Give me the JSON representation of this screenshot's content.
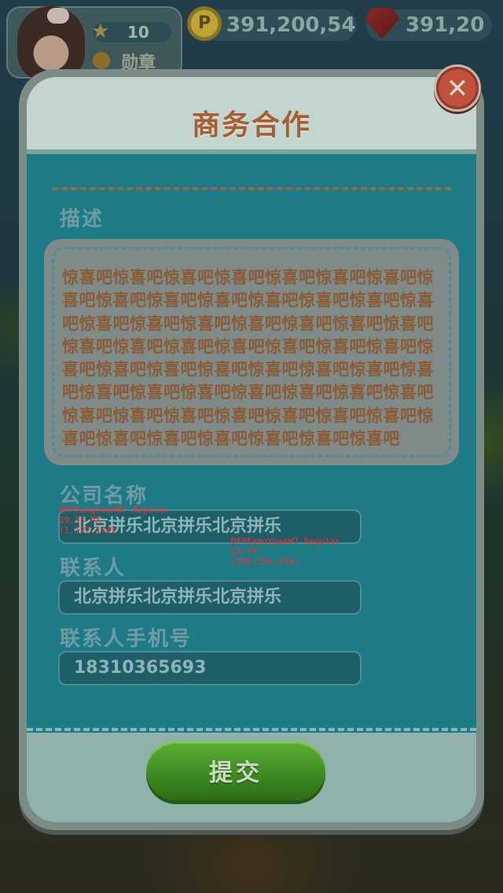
{
  "hud": {
    "level": "10",
    "medal_label": "勋章",
    "coins": "391,200,54",
    "gems": "391,20"
  },
  "dialog": {
    "title": "商务合作",
    "description_label": "描述",
    "description_text": "惊喜吧惊喜吧惊喜吧惊喜吧惊喜吧惊喜吧惊喜吧惊喜吧惊喜吧惊喜吧惊喜吧惊喜吧惊喜吧惊喜吧惊喜吧惊喜吧惊喜吧惊喜吧惊喜吧惊喜吧惊喜吧惊喜吧惊喜吧惊喜吧惊喜吧惊喜吧惊喜吧惊喜吧惊喜吧惊喜吧惊喜吧惊喜吧惊喜吧惊喜吧惊喜吧惊喜吧惊喜吧惊喜吧惊喜吧惊喜吧惊喜吧惊喜吧惊喜吧惊喜吧惊喜吧惊喜吧惊喜吧惊喜吧惊喜吧惊喜吧惊喜吧惊喜吧惊喜吧惊喜吧惊喜吧惊喜吧惊喜吧惊喜吧",
    "company_label": "公司名称",
    "company_value": "北京拼乐北京拼乐北京拼乐",
    "contact_label": "联系人",
    "contact_value": "北京拼乐北京拼乐北京拼乐",
    "phone_label": "联系人手机号",
    "phone_value": "18310365693",
    "submit_label": "提交"
  },
  "annotations": {
    "font_spec_1": "DFPFangYuanW7 Regular\n29.33 PX\n(1,127,174)",
    "font_spec_2": "DFPFangYuanW7 Regular\n24 PX\n(255,254,254)"
  },
  "colors": {
    "title": "#a0603a",
    "body": "#1f7a88",
    "submit": "#3f8d22",
    "close": "#c0523d"
  },
  "icons": {
    "close": "close-icon",
    "coin": "coin-icon",
    "gem": "gem-icon",
    "star": "star-icon",
    "medal": "medal-icon"
  }
}
